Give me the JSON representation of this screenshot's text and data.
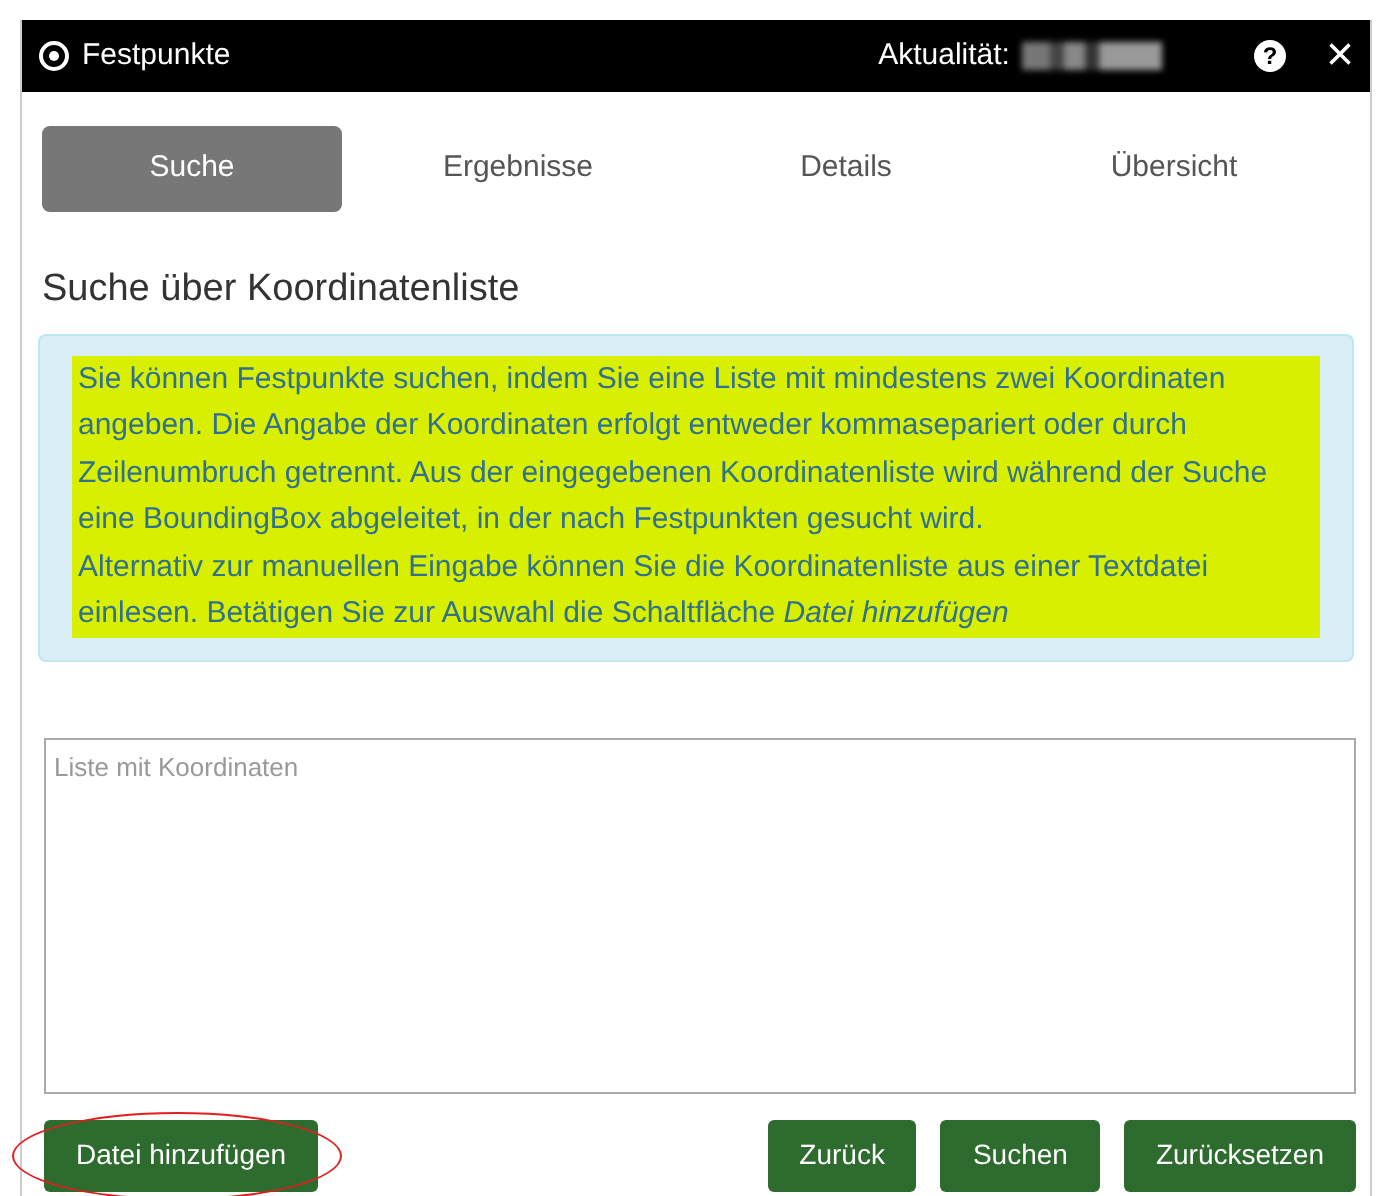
{
  "window": {
    "title": "Festpunkte",
    "currency_label": "Aktualität:",
    "help": "?",
    "close": "×"
  },
  "tabs": [
    {
      "label": "Suche",
      "selected": true
    },
    {
      "label": "Ergebnisse",
      "selected": false
    },
    {
      "label": "Details",
      "selected": false
    },
    {
      "label": "Übersicht",
      "selected": false
    }
  ],
  "heading": "Suche über Koordinatenliste",
  "info": {
    "highlighted": true,
    "paragraphs": [
      "Sie können Festpunkte suchen, indem Sie eine Liste mit mindestens zwei Koordinaten angeben. Die Angabe der Koordinaten erfolgt entweder kommasepariert oder durch Zeilenumbruch getrennt. Aus der eingegebenen Koordinatenliste wird während der Suche eine BoundingBox abgeleitet, in der nach Festpunkten gesucht wird.",
      "Alternativ zur manuellen Eingabe können Sie die Koordinatenliste aus einer Textdatei einlesen. Betätigen Sie zur Auswahl die Schaltfläche *Datei hinzufügen*"
    ]
  },
  "coordinates_field": {
    "placeholder": "Liste mit Koordinaten"
  },
  "buttons": [
    {
      "label": "Datei hinzufügen",
      "circled": true
    },
    {
      "label": "Zurück",
      "circled": false
    },
    {
      "label": "Suchen",
      "circled": false
    },
    {
      "label": "Zurücksetzen",
      "circled": false
    }
  ]
}
